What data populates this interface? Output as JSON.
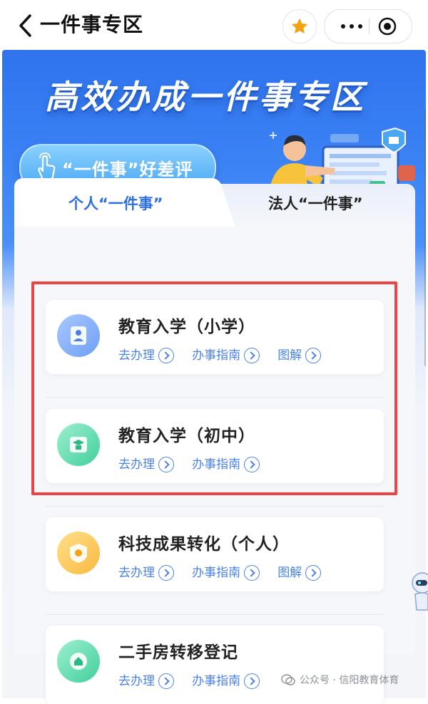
{
  "nav": {
    "title": "一件事专区",
    "icons": {
      "back": "chevron-left-icon",
      "favorite": "star-icon",
      "more": "more-dots-icon",
      "close": "target-icon"
    },
    "accent": "#f2a313"
  },
  "banner": {
    "title": "高效办成一件事专区",
    "rate_button": "“一件事”好差评"
  },
  "tabs": [
    {
      "label": "个人“一件事”",
      "active": true
    },
    {
      "label": "法人“一件事”",
      "active": false
    }
  ],
  "cards": [
    {
      "title": "教育入学（小学）",
      "icon": "student-icon",
      "actions": [
        "去办理",
        "办事指南",
        "图解"
      ]
    },
    {
      "title": "教育入学（初中）",
      "icon": "school-icon",
      "actions": [
        "去办理",
        "办事指南"
      ]
    },
    {
      "title": "科技成果转化（个人）",
      "icon": "tech-achievement-icon",
      "actions": [
        "去办理",
        "办事指南",
        "图解"
      ]
    },
    {
      "title": "二手房转移登记",
      "icon": "house-transfer-icon",
      "actions": [
        "去办理",
        "办事指南"
      ]
    }
  ],
  "watermark": "公众号 · 信阳教育体育",
  "colors": {
    "brand_blue": "#2f73ee",
    "link_blue": "#4a82e8",
    "highlight_red": "#ea4444"
  }
}
